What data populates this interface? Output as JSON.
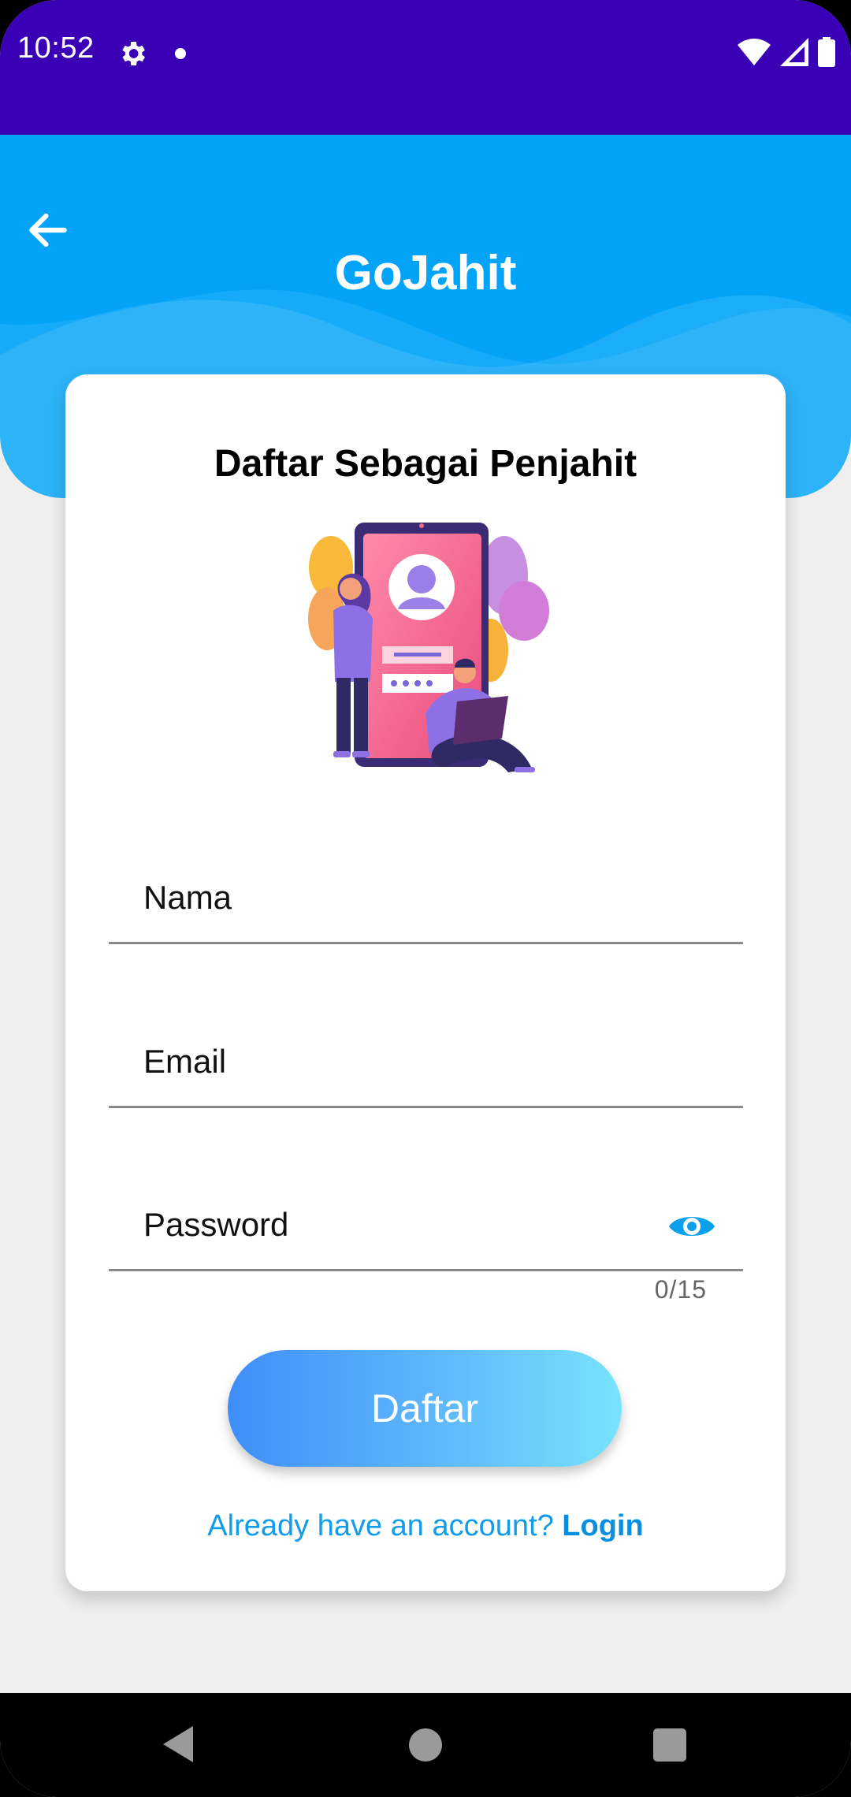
{
  "status_bar": {
    "time": "10:52",
    "icons": [
      "gear-icon",
      "notification-dot-icon",
      "wifi-icon",
      "signal-icon",
      "battery-icon"
    ]
  },
  "header": {
    "title": "GoJahit",
    "back_icon": "arrow-left-icon",
    "color": "#03a4f8"
  },
  "card": {
    "title": "Daftar Sebagai Penjahit",
    "fields": {
      "name_placeholder": "Nama",
      "email_placeholder": "Email",
      "password_placeholder": "Password",
      "password_counter": "0/15"
    },
    "submit_label": "Daftar",
    "login_prompt": "Already have an account?",
    "login_link": "Login"
  },
  "colors": {
    "status_bar": "#3a00b6",
    "accent": "#03a4f8",
    "link": "#139ce8"
  }
}
